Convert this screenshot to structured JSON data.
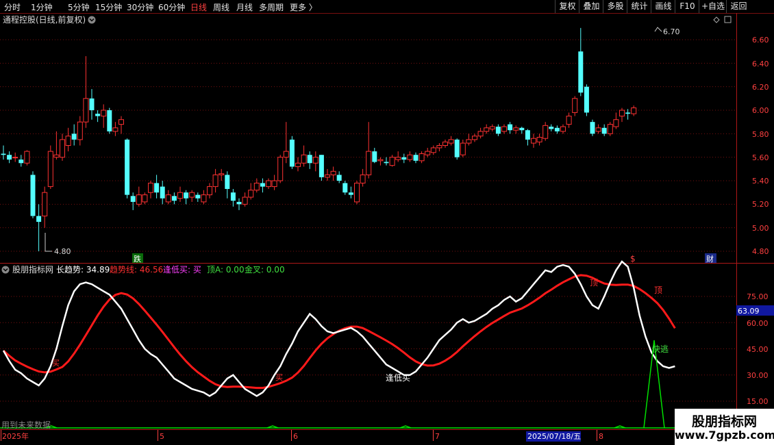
{
  "toolbar": {
    "timeframes": [
      "分时",
      "1分钟",
      "5分钟",
      "15分钟",
      "30分钟",
      "60分钟",
      "日线",
      "周线",
      "月线",
      "多周期",
      "更多 〉"
    ],
    "active": "日线",
    "right_buttons": [
      "复权",
      "叠加",
      "多股",
      "统计",
      "画线",
      "F10",
      "+自选",
      "返回"
    ]
  },
  "price_panel": {
    "title": "通程控股(日线,前复权)",
    "high_label": "6.70",
    "low_label": "4.80",
    "axis_labels": [
      "6.60",
      "6.40",
      "6.20",
      "6.00",
      "5.80",
      "5.60",
      "5.40",
      "5.20",
      "5.00",
      "4.80"
    ],
    "markers": [
      "跌",
      "$",
      "财"
    ]
  },
  "indicator_panel": {
    "name": "股朋指标网",
    "values": [
      {
        "label": "长趋势: 34.89",
        "color": "#ffffff"
      },
      {
        "label": "趋势线: 46.56",
        "color": "#ff3030"
      },
      {
        "label": "逢低买: 买",
        "color": "#ff40ff"
      },
      {
        "label": "顶A: 0.00",
        "color": "#40e040"
      },
      {
        "label": "金叉: 0.00",
        "color": "#40e040"
      }
    ],
    "axis_labels": [
      "75.00",
      "60.00",
      "45.00",
      "30.00",
      "15.00"
    ],
    "current_value": "63.09",
    "annotations": {
      "top1": "顶",
      "top2": "顶",
      "buy1": "买",
      "buy2": "买",
      "low_buy": "逢低买",
      "escape": "快逃"
    },
    "warning": "用到未来数据"
  },
  "date_axis": {
    "labels": [
      "2025年",
      "5",
      "6",
      "7",
      "8"
    ],
    "cursor_date": "2025/07/18/五"
  },
  "watermark": {
    "line1": "股朋指标网",
    "line2": "www.7gpzb.com"
  },
  "colors": {
    "up": "#ff3232",
    "down": "#54ffff",
    "long_trend": "#ffffff",
    "trend_line": "#ff1a1a",
    "signal": "#00e000",
    "grid": "#7a1010"
  },
  "chart_data": {
    "type": "candlestick",
    "ylim": [
      4.8,
      6.7
    ],
    "candles": [
      [
        5.63,
        5.62,
        5.7,
        5.58
      ],
      [
        5.62,
        5.58,
        5.65,
        5.55
      ],
      [
        5.6,
        5.6,
        5.64,
        5.56
      ],
      [
        5.58,
        5.55,
        5.62,
        5.52
      ],
      [
        5.55,
        5.65,
        5.66,
        5.53
      ],
      [
        5.45,
        5.1,
        5.48,
        5.08
      ],
      [
        5.1,
        5.05,
        5.2,
        4.8
      ],
      [
        5.1,
        5.3,
        5.35,
        5.0
      ],
      [
        5.35,
        5.65,
        5.7,
        5.33
      ],
      [
        5.6,
        5.62,
        5.82,
        5.58
      ],
      [
        5.6,
        5.75,
        5.8,
        5.57
      ],
      [
        5.7,
        5.78,
        5.85,
        5.65
      ],
      [
        5.8,
        5.75,
        5.88,
        5.7
      ],
      [
        5.75,
        5.9,
        5.95,
        5.7
      ],
      [
        5.9,
        6.1,
        6.46,
        5.85
      ],
      [
        6.1,
        6.0,
        6.18,
        5.92
      ],
      [
        5.97,
        5.95,
        6.0,
        5.9
      ],
      [
        5.95,
        6.0,
        6.05,
        5.85
      ],
      [
        6.0,
        5.82,
        6.02,
        5.8
      ],
      [
        5.82,
        5.85,
        5.9,
        5.78
      ],
      [
        5.88,
        5.92,
        5.95,
        5.8
      ],
      [
        5.75,
        5.28,
        5.76,
        5.25
      ],
      [
        5.27,
        5.22,
        5.3,
        5.15
      ],
      [
        5.2,
        5.28,
        5.35,
        5.18
      ],
      [
        5.22,
        5.28,
        5.3,
        5.2
      ],
      [
        5.3,
        5.38,
        5.4,
        5.25
      ],
      [
        5.38,
        5.3,
        5.45,
        5.25
      ],
      [
        5.35,
        5.25,
        5.4,
        5.2
      ],
      [
        5.22,
        5.28,
        5.32,
        5.2
      ],
      [
        5.27,
        5.23,
        5.3,
        5.2
      ],
      [
        5.25,
        5.3,
        5.35,
        5.22
      ],
      [
        5.3,
        5.25,
        5.32,
        5.2
      ],
      [
        5.26,
        5.3,
        5.32,
        5.22
      ],
      [
        5.28,
        5.25,
        5.3,
        5.22
      ],
      [
        5.22,
        5.28,
        5.32,
        5.2
      ],
      [
        5.28,
        5.35,
        5.38,
        5.25
      ],
      [
        5.35,
        5.45,
        5.5,
        5.3
      ],
      [
        5.45,
        5.46,
        5.5,
        5.4
      ],
      [
        5.45,
        5.33,
        5.48,
        5.25
      ],
      [
        5.3,
        5.23,
        5.33,
        5.18
      ],
      [
        5.22,
        5.2,
        5.25,
        5.15
      ],
      [
        5.2,
        5.26,
        5.3,
        5.18
      ],
      [
        5.26,
        5.32,
        5.38,
        5.24
      ],
      [
        5.32,
        5.38,
        5.42,
        5.3
      ],
      [
        5.38,
        5.35,
        5.42,
        5.3
      ],
      [
        5.35,
        5.4,
        5.42,
        5.33
      ],
      [
        5.35,
        5.4,
        5.45,
        5.32
      ],
      [
        5.4,
        5.6,
        5.62,
        5.38
      ],
      [
        5.6,
        5.65,
        5.9,
        5.55
      ],
      [
        5.75,
        5.52,
        5.78,
        5.5
      ],
      [
        5.52,
        5.55,
        5.6,
        5.48
      ],
      [
        5.55,
        5.62,
        5.7,
        5.52
      ],
      [
        5.62,
        5.55,
        5.65,
        5.5
      ],
      [
        5.55,
        5.6,
        5.65,
        5.48
      ],
      [
        5.62,
        5.43,
        5.62,
        5.4
      ],
      [
        5.43,
        5.45,
        5.5,
        5.4
      ],
      [
        5.45,
        5.48,
        5.52,
        5.4
      ],
      [
        5.45,
        5.4,
        5.48,
        5.38
      ],
      [
        5.38,
        5.3,
        5.4,
        5.28
      ],
      [
        5.3,
        5.28,
        5.35,
        5.25
      ],
      [
        5.22,
        5.38,
        5.4,
        5.2
      ],
      [
        5.38,
        5.45,
        5.5,
        5.35
      ],
      [
        5.45,
        5.65,
        5.9,
        5.42
      ],
      [
        5.65,
        5.56,
        5.68,
        5.55
      ],
      [
        5.57,
        5.58,
        5.6,
        5.53
      ],
      [
        5.56,
        5.55,
        5.6,
        5.53
      ],
      [
        5.53,
        5.6,
        5.62,
        5.52
      ],
      [
        5.58,
        5.6,
        5.65,
        5.56
      ],
      [
        5.6,
        5.58,
        5.63,
        5.55
      ],
      [
        5.58,
        5.62,
        5.65,
        5.56
      ],
      [
        5.62,
        5.57,
        5.64,
        5.55
      ],
      [
        5.57,
        5.63,
        5.65,
        5.55
      ],
      [
        5.62,
        5.65,
        5.68,
        5.6
      ],
      [
        5.64,
        5.68,
        5.7,
        5.62
      ],
      [
        5.68,
        5.7,
        5.72,
        5.65
      ],
      [
        5.7,
        5.73,
        5.75,
        5.68
      ],
      [
        5.72,
        5.75,
        5.78,
        5.7
      ],
      [
        5.75,
        5.6,
        5.76,
        5.58
      ],
      [
        5.62,
        5.72,
        5.75,
        5.6
      ],
      [
        5.72,
        5.75,
        5.8,
        5.7
      ],
      [
        5.75,
        5.78,
        5.8,
        5.73
      ],
      [
        5.78,
        5.82,
        5.85,
        5.76
      ],
      [
        5.82,
        5.85,
        5.88,
        5.8
      ],
      [
        5.84,
        5.86,
        5.88,
        5.82
      ],
      [
        5.86,
        5.8,
        5.88,
        5.78
      ],
      [
        5.82,
        5.86,
        5.88,
        5.8
      ],
      [
        5.88,
        5.83,
        5.9,
        5.8
      ],
      [
        5.83,
        5.85,
        5.87,
        5.8
      ],
      [
        5.85,
        5.83,
        5.86,
        5.8
      ],
      [
        5.83,
        5.75,
        5.84,
        5.7
      ],
      [
        5.72,
        5.76,
        5.8,
        5.68
      ],
      [
        5.73,
        5.77,
        5.8,
        5.7
      ],
      [
        5.76,
        5.87,
        5.9,
        5.74
      ],
      [
        5.86,
        5.84,
        5.88,
        5.82
      ],
      [
        5.85,
        5.82,
        5.87,
        5.8
      ],
      [
        5.82,
        5.86,
        5.88,
        5.8
      ],
      [
        5.88,
        5.95,
        5.98,
        5.85
      ],
      [
        5.98,
        6.1,
        6.12,
        5.95
      ],
      [
        6.5,
        6.15,
        6.7,
        6.12
      ],
      [
        6.2,
        5.98,
        6.22,
        5.95
      ],
      [
        5.9,
        5.8,
        5.92,
        5.78
      ],
      [
        5.82,
        5.85,
        5.88,
        5.8
      ],
      [
        5.85,
        5.8,
        5.88,
        5.78
      ],
      [
        5.8,
        5.88,
        5.9,
        5.78
      ],
      [
        5.86,
        5.92,
        5.98,
        5.84
      ],
      [
        5.95,
        6.0,
        6.02,
        5.9
      ],
      [
        5.98,
        5.97,
        6.01,
        5.92
      ],
      [
        5.97,
        6.02,
        6.04,
        5.95
      ]
    ],
    "long_trend": [
      44,
      38,
      33,
      31,
      28,
      26,
      24,
      28,
      35,
      45,
      58,
      70,
      78,
      82,
      83,
      82,
      80,
      78,
      76,
      72,
      68,
      62,
      56,
      50,
      45,
      42,
      40,
      36,
      32,
      28,
      26,
      24,
      22,
      21,
      20,
      18,
      20,
      24,
      28,
      30,
      26,
      22,
      20,
      18,
      20,
      24,
      30,
      35,
      42,
      48,
      55,
      60,
      65,
      62,
      58,
      55,
      54,
      55,
      56,
      57,
      55,
      52,
      48,
      44,
      40,
      36,
      34,
      32,
      30,
      30,
      32,
      36,
      40,
      45,
      50,
      53,
      56,
      60,
      62,
      60,
      61,
      63,
      65,
      68,
      70,
      73,
      75,
      72,
      74,
      78,
      82,
      86,
      90,
      89,
      92,
      93,
      92,
      88,
      82,
      75,
      70,
      68,
      75,
      83,
      90,
      95,
      92,
      80,
      64,
      52,
      43,
      38,
      35,
      34,
      35
    ]
  }
}
